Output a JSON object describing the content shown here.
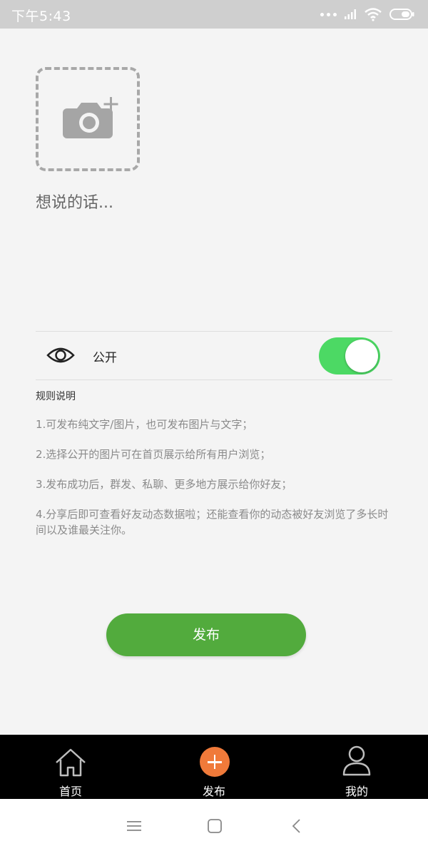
{
  "status_bar": {
    "time": "下午5:43"
  },
  "upload": {
    "icon": "camera-add-icon"
  },
  "composer": {
    "placeholder": "想说的话..."
  },
  "visibility": {
    "label": "公开",
    "icon": "eye-icon",
    "enabled": true,
    "toggle_color": "#4cd964"
  },
  "rules": {
    "title": "规则说明",
    "items": [
      "1.可发布纯文字/图片，也可发布图片与文字；",
      "2.选择公开的图片可在首页展示给所有用户浏览；",
      "3.发布成功后，群发、私聊、更多地方展示给你好友；",
      "4.分享后即可查看好友动态数据啦；还能查看你的动态被好友浏览了多长时间以及谁最关注你。"
    ]
  },
  "publish_button": {
    "label": "发布",
    "color": "#52ab3d"
  },
  "tabbar": {
    "tabs": [
      {
        "label": "首页",
        "icon": "home-icon"
      },
      {
        "label": "发布",
        "icon": "plus-circle-icon",
        "color": "#f07a3a"
      },
      {
        "label": "我的",
        "icon": "user-icon"
      }
    ]
  },
  "navbar": {
    "icons": [
      "menu-icon",
      "home-square-icon",
      "back-icon"
    ]
  }
}
